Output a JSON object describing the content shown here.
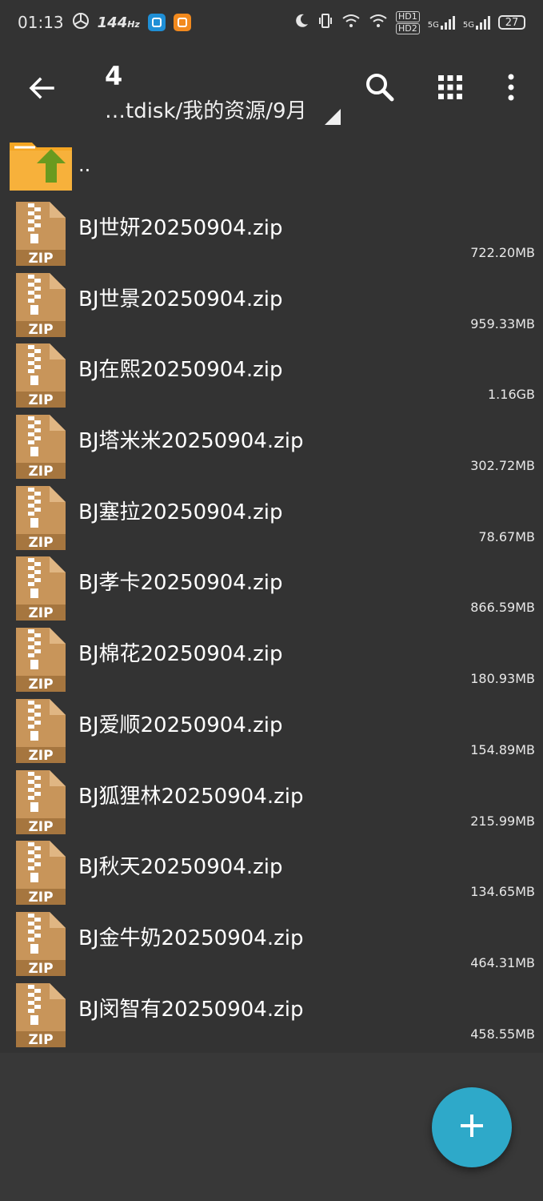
{
  "status_bar": {
    "time": "01:13",
    "refresh": "144",
    "refresh_unit": "Hz",
    "hd1": "HD1",
    "hd2": "HD2",
    "net1": "5G",
    "net2": "5G",
    "battery": "27"
  },
  "toolbar": {
    "title": "4",
    "path": "…tdisk/我的资源/9月"
  },
  "list": {
    "parent_label": "..",
    "files": [
      {
        "name": "BJ世妍20250904.zip",
        "size": "722.20MB"
      },
      {
        "name": "BJ世景20250904.zip",
        "size": "959.33MB"
      },
      {
        "name": "BJ在熙20250904.zip",
        "size": "1.16GB"
      },
      {
        "name": "BJ塔米米20250904.zip",
        "size": "302.72MB"
      },
      {
        "name": "BJ塞拉20250904.zip",
        "size": "78.67MB"
      },
      {
        "name": "BJ孝卡20250904.zip",
        "size": "866.59MB"
      },
      {
        "name": "BJ棉花20250904.zip",
        "size": "180.93MB"
      },
      {
        "name": "BJ爱顺20250904.zip",
        "size": "154.89MB"
      },
      {
        "name": "BJ狐狸林20250904.zip",
        "size": "215.99MB"
      },
      {
        "name": "BJ秋天20250904.zip",
        "size": "134.65MB"
      },
      {
        "name": "BJ金牛奶20250904.zip",
        "size": "464.31MB"
      },
      {
        "name": "BJ闵智有20250904.zip",
        "size": "458.55MB"
      }
    ],
    "zip_label": "ZIP"
  },
  "icons": {
    "back": "arrow-left-icon",
    "search": "search-icon",
    "grid": "grid-view-icon",
    "more": "more-vert-icon",
    "fab": "plus-icon"
  },
  "colors": {
    "background": "#333333",
    "zip_icon": "#c8955a",
    "folder": "#f5a623",
    "folder_arrow": "#6a9a1f",
    "fab": "#2ea9c9"
  }
}
